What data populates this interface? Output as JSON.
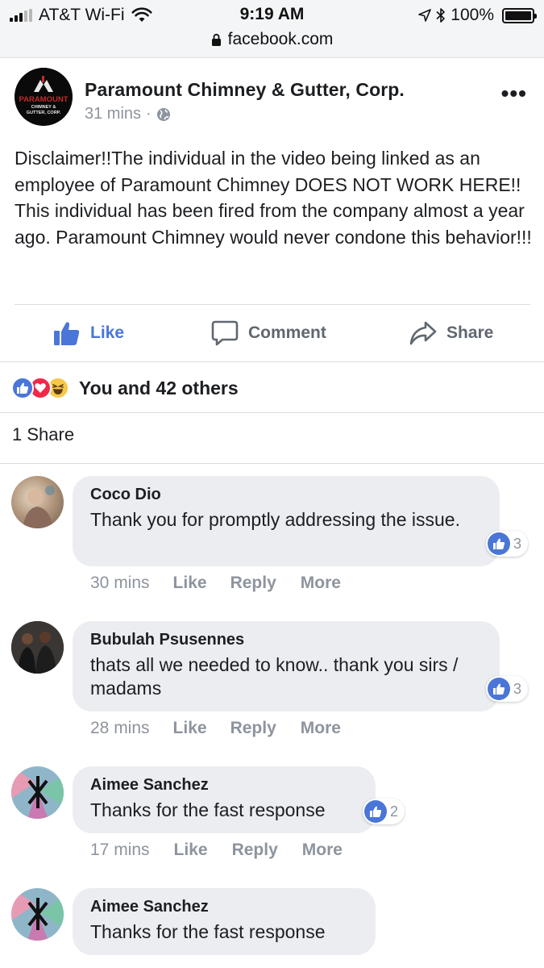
{
  "status_bar": {
    "carrier": "AT&T Wi-Fi",
    "time": "9:19 AM",
    "battery": "100%",
    "battery_level": 1.0,
    "url": "facebook.com"
  },
  "post": {
    "page_name": "Paramount Chimney & Gutter, Corp.",
    "timestamp": "31 mins",
    "separator": "·",
    "logo_text": [
      "PARAMOUNT",
      "CHIMNEY &",
      "GUTTER, CORP."
    ],
    "text": "Disclaimer!!The individual in the video being linked as an employee of Paramount Chimney DOES NOT WORK HERE!! This individual has been fired from the company almost a year ago. Paramount Chimney would never condone this behavior!!!",
    "actions": {
      "like": "Like",
      "comment": "Comment",
      "share": "Share"
    },
    "reactions_summary": "You and 42 others",
    "reaction_types": [
      "like-icon",
      "love-icon",
      "haha-icon"
    ],
    "shares": "1 Share"
  },
  "comments": [
    {
      "name": "Coco Dio",
      "text": "Thank you for promptly addressing the issue.",
      "likes": "3",
      "time": "30 mins",
      "like": "Like",
      "reply": "Reply",
      "more": "More"
    },
    {
      "name": "Bubulah Psusennes",
      "text": "thats all we needed to know.. thank you sirs / madams",
      "likes": "3",
      "time": "28 mins",
      "like": "Like",
      "reply": "Reply",
      "more": "More"
    },
    {
      "name": "Aimee Sanchez",
      "text": "Thanks for the fast response",
      "likes": "2",
      "time": "17 mins",
      "like": "Like",
      "reply": "Reply",
      "more": "More"
    },
    {
      "name": "Aimee Sanchez",
      "text": "Thanks for the fast response"
    }
  ],
  "colors": {
    "brand_blue": "#4a76d8",
    "love_red": "#f0284a",
    "haha_yellow": "#f7c748",
    "bubble_gray": "#ebedf0",
    "meta_gray": "#8d949e"
  }
}
